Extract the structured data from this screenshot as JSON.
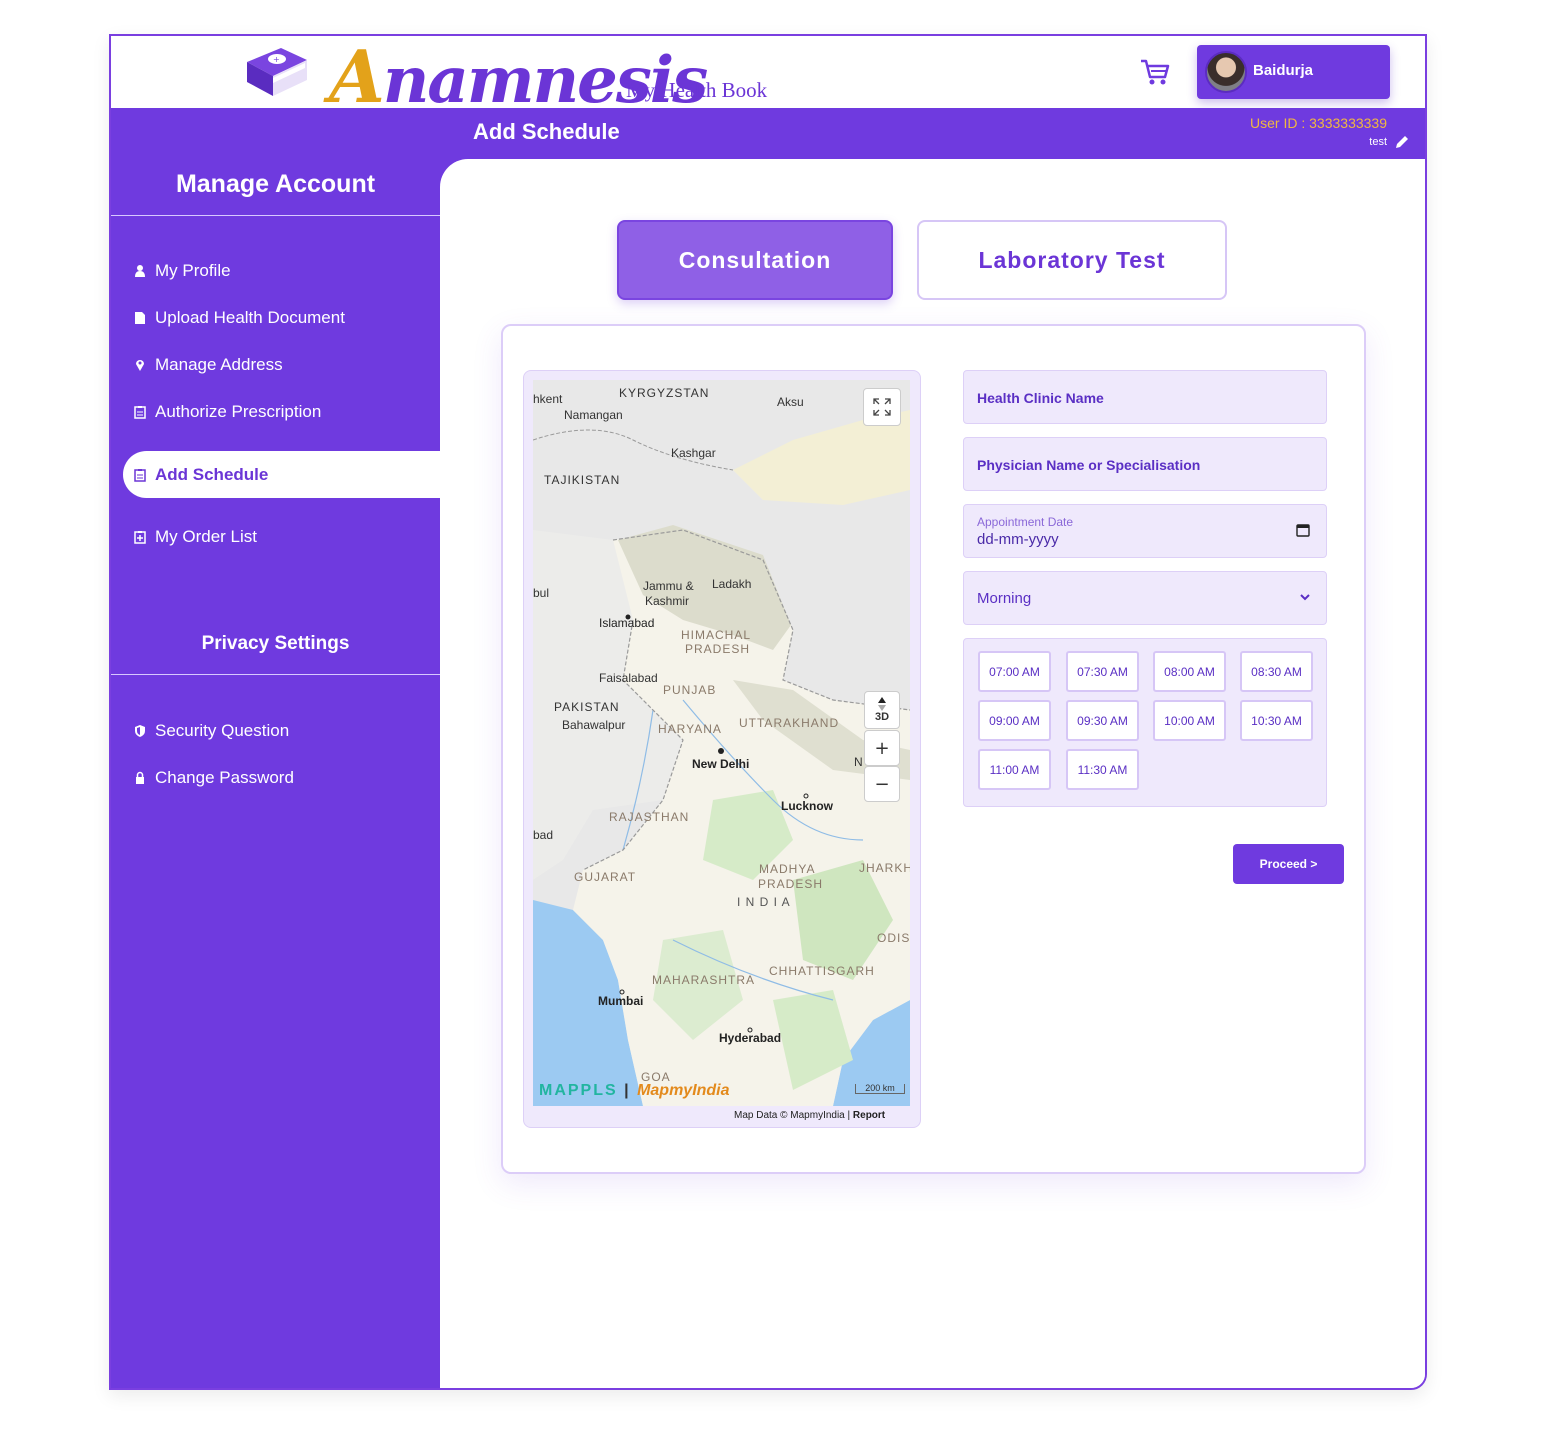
{
  "brand": {
    "logo_word_first": "A",
    "logo_word_rest": "namnesis",
    "tagline": "My Health Book"
  },
  "header": {
    "user_name": "Baidurja",
    "page_title": "Add Schedule",
    "user_id": "User ID : 3333333339",
    "user_sub": "test"
  },
  "sidebar": {
    "heading": "Manage Account",
    "items": [
      {
        "label": "My Profile",
        "icon": "user-icon"
      },
      {
        "label": "Upload Health Document",
        "icon": "file-icon"
      },
      {
        "label": "Manage Address",
        "icon": "map-pin-icon"
      },
      {
        "label": "Authorize Prescription",
        "icon": "clipboard-icon"
      },
      {
        "label": "Add Schedule",
        "icon": "clipboard-icon"
      },
      {
        "label": "My Order List",
        "icon": "clipboard-plus-icon"
      }
    ],
    "privacy_heading": "Privacy Settings",
    "privacy_items": [
      {
        "label": "Security Question",
        "icon": "shield-icon"
      },
      {
        "label": "Change Password",
        "icon": "lock-icon"
      }
    ]
  },
  "tabs": {
    "consultation": "Consultation",
    "laboratory": "Laboratory Test"
  },
  "map": {
    "labels": {
      "kyrgyzstan": "KYRGYZSTAN",
      "tashkent": "hkent",
      "namangan": "Namangan",
      "aksu": "Aksu",
      "kashgar": "Kashgar",
      "tajikistan": "TAJIKISTAN",
      "kabul": "bul",
      "jammu": "Jammu &",
      "kashmir": "Kashmir",
      "ladakh": "Ladakh",
      "islamabad": "Islamabad",
      "himachal": "HIMACHAL",
      "pradesh_hp": "PRADESH",
      "faisalabad": "Faisalabad",
      "punjab": "PUNJAB",
      "pakistan": "PAKISTAN",
      "bahawalpur": "Bahawalpur",
      "haryana": "HARYANA",
      "uttarakhand": "UTTARAKHAND",
      "newdelhi": "New Delhi",
      "n": "N",
      "lucknow": "Lucknow",
      "rajasthan": "RAJASTHAN",
      "bad": "bad",
      "madhya": "MADHYA",
      "pradesh_mp": "PRADESH",
      "jharkh": "JHARKH",
      "gujarat": "GUJARAT",
      "india": "I N D I A",
      "odis": "ODIS",
      "maharashtra": "MAHARASHTRA",
      "chhattisgarh": "CHHATTISGARH",
      "mumbai": "Mumbai",
      "hyderabad": "Hyderabad",
      "goa": "GOA"
    },
    "controls": {
      "three_d": "3D",
      "zoom_in": "+",
      "zoom_out": "−"
    },
    "brand_mappls": "MAPPLS",
    "brand_sep": "|",
    "brand_mapmyindia": "MapmyIndia",
    "scale": "200 km",
    "attribution": "Map Data © MapmyIndia | ",
    "report": "Report"
  },
  "form": {
    "clinic_placeholder": "Health Clinic Name",
    "physician_placeholder": "Physician Name or Specialisation",
    "date_label": "Appointment Date",
    "date_value": "dd-mm-yyyy",
    "session_selected": "Morning",
    "slots": [
      "07:00 AM",
      "07:30 AM",
      "08:00 AM",
      "08:30 AM",
      "09:00 AM",
      "09:30 AM",
      "10:00 AM",
      "10:30 AM",
      "11:00 AM",
      "11:30 AM"
    ],
    "proceed": "Proceed >"
  },
  "colors": {
    "primary": "#6f3adf",
    "accent": "#e3a21a",
    "tab_active": "#8f60e6",
    "field_bg": "#efe9fc"
  }
}
